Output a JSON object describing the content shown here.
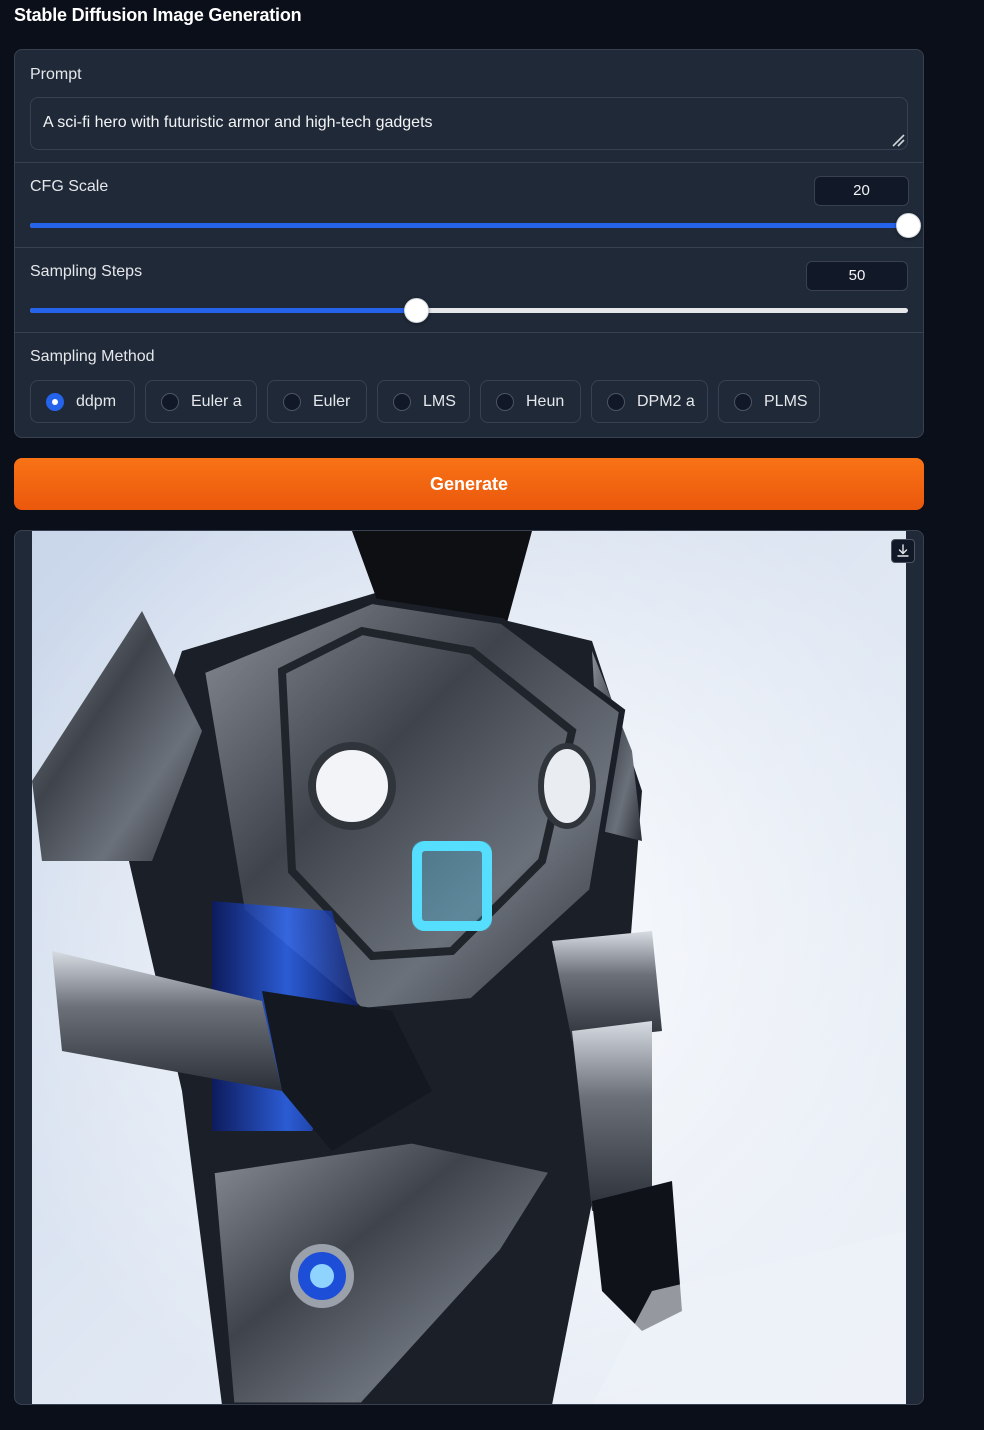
{
  "app": {
    "title": "Stable Diffusion Image Generation"
  },
  "prompt": {
    "label": "Prompt",
    "value": "A sci-fi hero with futuristic armor and high-tech gadgets"
  },
  "cfg_scale": {
    "label": "CFG Scale",
    "value": "20",
    "fraction": 1.0
  },
  "sampling_steps": {
    "label": "Sampling Steps",
    "value": "50",
    "fraction": 0.44
  },
  "sampling_method": {
    "label": "Sampling Method",
    "selected": "ddpm",
    "options": [
      "ddpm",
      "Euler a",
      "Euler",
      "LMS",
      "Heun",
      "DPM2 a",
      "PLMS"
    ]
  },
  "generate": {
    "label": "Generate"
  },
  "output": {
    "download_icon": "download-icon"
  },
  "colors": {
    "accent": "#2563eb",
    "button": "#f97316",
    "background": "#0b0f19",
    "panel": "#1f2937"
  }
}
